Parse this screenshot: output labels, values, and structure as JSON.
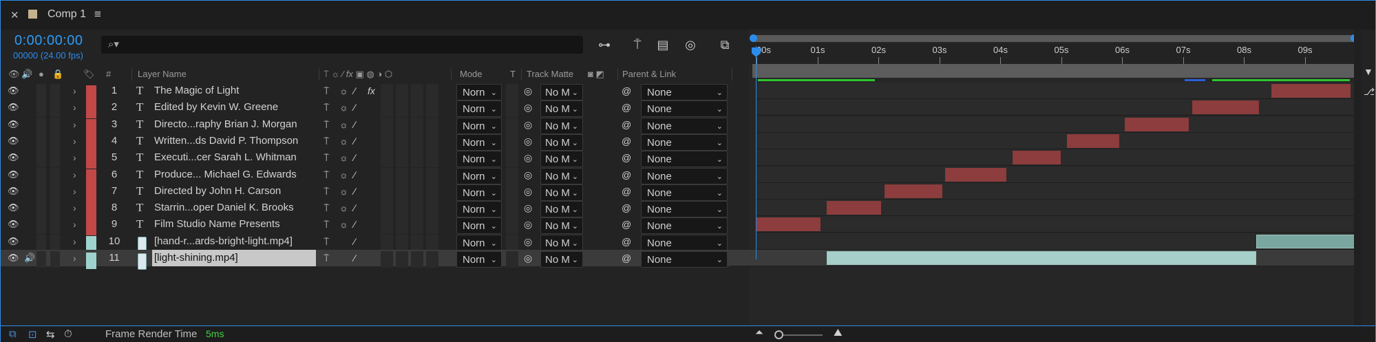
{
  "tab": {
    "title": "Comp 1",
    "close_icon": "close-icon",
    "menu_icon": "hamburger-menu-icon"
  },
  "header": {
    "timecode": "0:00:00:00",
    "frame_fps": "00000 (24.00 fps)",
    "search_placeholder": ""
  },
  "columns": {
    "label": "#",
    "layer_name": "Layer Name",
    "mode": "Mode",
    "t": "T",
    "track_matte": "Track Matte",
    "parent_link": "Parent & Link"
  },
  "layers": [
    {
      "num": "1",
      "type": "text",
      "name": "The Magic of Light",
      "mode": "Norn",
      "track_matte": "No M",
      "parent": "None",
      "color": "#c24848",
      "has_fx": true
    },
    {
      "num": "2",
      "type": "text",
      "name": "Edited by  Kevin W. Greene",
      "mode": "Norn",
      "track_matte": "No M",
      "parent": "None",
      "color": "#c24848"
    },
    {
      "num": "3",
      "type": "text",
      "name": "Directo...raphy  Brian J. Morgan",
      "mode": "Norn",
      "track_matte": "No M",
      "parent": "None",
      "color": "#c24848"
    },
    {
      "num": "4",
      "type": "text",
      "name": "Written...ds David P. Thompson",
      "mode": "Norn",
      "track_matte": "No M",
      "parent": "None",
      "color": "#c24848"
    },
    {
      "num": "5",
      "type": "text",
      "name": "Executi...cer  Sarah L. Whitman",
      "mode": "Norn",
      "track_matte": "No M",
      "parent": "None",
      "color": "#c24848"
    },
    {
      "num": "6",
      "type": "text",
      "name": "Produce...  Michael G. Edwards",
      "mode": "Norn",
      "track_matte": "No M",
      "parent": "None",
      "color": "#c24848"
    },
    {
      "num": "7",
      "type": "text",
      "name": "Directed by  John H. Carson",
      "mode": "Norn",
      "track_matte": "No M",
      "parent": "None",
      "color": "#c24848"
    },
    {
      "num": "8",
      "type": "text",
      "name": "Starrin...oper Daniel K. Brooks",
      "mode": "Norn",
      "track_matte": "No M",
      "parent": "None",
      "color": "#c24848"
    },
    {
      "num": "9",
      "type": "text",
      "name": "Film Studio Name Presents",
      "mode": "Norn",
      "track_matte": "No M",
      "parent": "None",
      "color": "#c24848"
    },
    {
      "num": "10",
      "type": "footage",
      "name": "[hand-r...ards-bright-light.mp4]",
      "mode": "Norn",
      "track_matte": "No M",
      "parent": "None",
      "color": "#9fd2cd"
    },
    {
      "num": "11",
      "type": "footage",
      "name": "[light-shining.mp4]",
      "mode": "Norn",
      "track_matte": "No M",
      "parent": "None",
      "color": "#9fd2cd",
      "selected": true,
      "audio": true
    }
  ],
  "ruler": {
    "ticks": [
      "00s",
      "01s",
      "02s",
      "03s",
      "04s",
      "05s",
      "06s",
      "07s",
      "08s",
      "09s"
    ]
  },
  "bars": [
    {
      "layer": 1,
      "start": 8.45,
      "end": 9.75,
      "kind": "red"
    },
    {
      "layer": 2,
      "start": 7.15,
      "end": 8.25,
      "kind": "red"
    },
    {
      "layer": 3,
      "start": 6.05,
      "end": 7.1,
      "kind": "red"
    },
    {
      "layer": 4,
      "start": 5.1,
      "end": 5.95,
      "kind": "red"
    },
    {
      "layer": 5,
      "start": 4.2,
      "end": 5.0,
      "kind": "red"
    },
    {
      "layer": 6,
      "start": 3.1,
      "end": 4.1,
      "kind": "red"
    },
    {
      "layer": 7,
      "start": 2.1,
      "end": 3.05,
      "kind": "red"
    },
    {
      "layer": 8,
      "start": 1.15,
      "end": 2.05,
      "kind": "red"
    },
    {
      "layer": 9,
      "start": 0.0,
      "end": 1.05,
      "kind": "red"
    },
    {
      "layer": 10,
      "start": 8.2,
      "end": 9.9,
      "kind": "teal"
    },
    {
      "layer": 11,
      "start": 1.15,
      "end": 8.2,
      "kind": "teal"
    }
  ],
  "footer": {
    "render_label": "Frame Render Time",
    "render_value": "5ms"
  },
  "colors": {
    "accent": "#2d8ceb",
    "timecode": "#2d9cf6",
    "cache": "#2fc52f",
    "text_bar": "#8d3d3d",
    "footage_bar": "#7aa6a0"
  }
}
